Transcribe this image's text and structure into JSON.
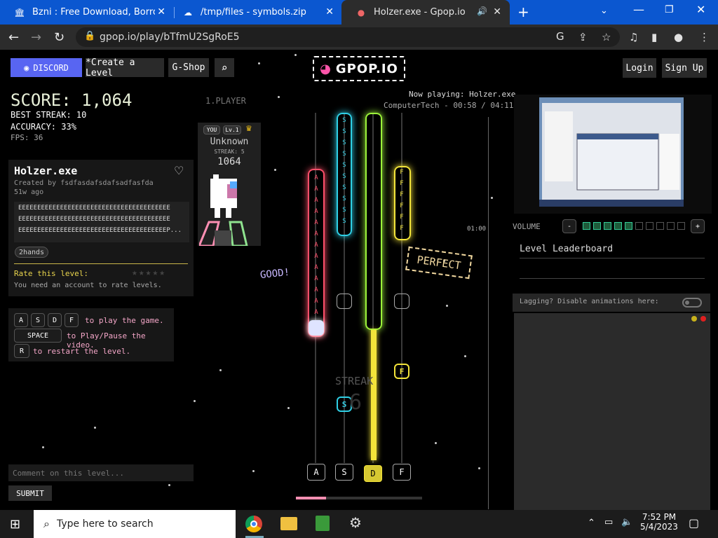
{
  "browser": {
    "tabs": [
      {
        "title": "Bzni : Free Download, Borrow, an",
        "icon": "archive-icon"
      },
      {
        "title": "/tmp/files - symbols.zip",
        "icon": "cloud-icon"
      },
      {
        "title": "Holzer.exe - Gpop.io",
        "icon": "gpop-icon",
        "active": true
      }
    ],
    "url": "gpop.io/play/bTfmU2SgRoE5"
  },
  "header": {
    "discord_label": "DISCORD",
    "create_label": "*Create a Level",
    "shop_label": "G-Shop",
    "logo_text": "GPOP.IO",
    "login_label": "Login",
    "signup_label": "Sign Up"
  },
  "stats": {
    "score": "SCORE: 1,064",
    "best_streak": "BEST STREAK: 10",
    "accuracy": "ACCURACY: 33%",
    "fps": "FPS: 36"
  },
  "player": {
    "heading": "1.PLAYER",
    "you": "YOU",
    "level": "Lv.1",
    "name": "Unknown",
    "streak": "STREAK: 5",
    "score": "1064"
  },
  "level": {
    "title": "Holzer.exe",
    "creator": "Created by fsdfasdafsdafsadfasfda",
    "age": "51w ago",
    "description": [
      "EEEEEEEEEEEEEEEEEEEEEEEEEEEEEEEEEEEEEEEE",
      "EEEEEEEEEEEEEEEEEEEEEEEEEEEEEEEEEEEEEEEE",
      "EEEEEEEEEEEEEEEEEEEEEEEEEEEEEEEEEEEEEEEP..."
    ],
    "tag": "2hands",
    "rate_label": "Rate this level:",
    "rate_note": "You need an account to rate levels."
  },
  "help": {
    "keys": [
      "A",
      "S",
      "D",
      "F"
    ],
    "play_text": "to play the game.",
    "space_key": "SPACE",
    "pause_text": "to Play/Pause the video.",
    "restart_key": "R",
    "restart_text": "to restart the level."
  },
  "comment": {
    "placeholder": "Comment on this level...",
    "submit": "SUBMIT"
  },
  "game": {
    "now_playing": "Now playing: Holzer.exe",
    "track_info": "ComputerTech - 00:58 / 04:11",
    "time_marker": "01:00",
    "good_text": "GOOD!",
    "perfect_text": "PERFECT",
    "streak_label": "STREAK",
    "streak_value": "6",
    "lane_keys": [
      "A",
      "S",
      "D",
      "F"
    ],
    "progress": 0.24,
    "colors": {
      "a": "#ff4f6a",
      "s": "#2fd0e6",
      "d": "#9cf23a",
      "f": "#f3e43a"
    }
  },
  "right": {
    "volume_label": "VOLUME",
    "volume_minus": "-",
    "volume_plus": "+",
    "volume_level": 5,
    "volume_max": 10,
    "leaderboard_title": "Level Leaderboard",
    "lag_text": "Lagging? Disable animations here:"
  },
  "taskbar": {
    "search_placeholder": "Type here to search",
    "time": "7:52 PM",
    "date": "5/4/2023"
  }
}
